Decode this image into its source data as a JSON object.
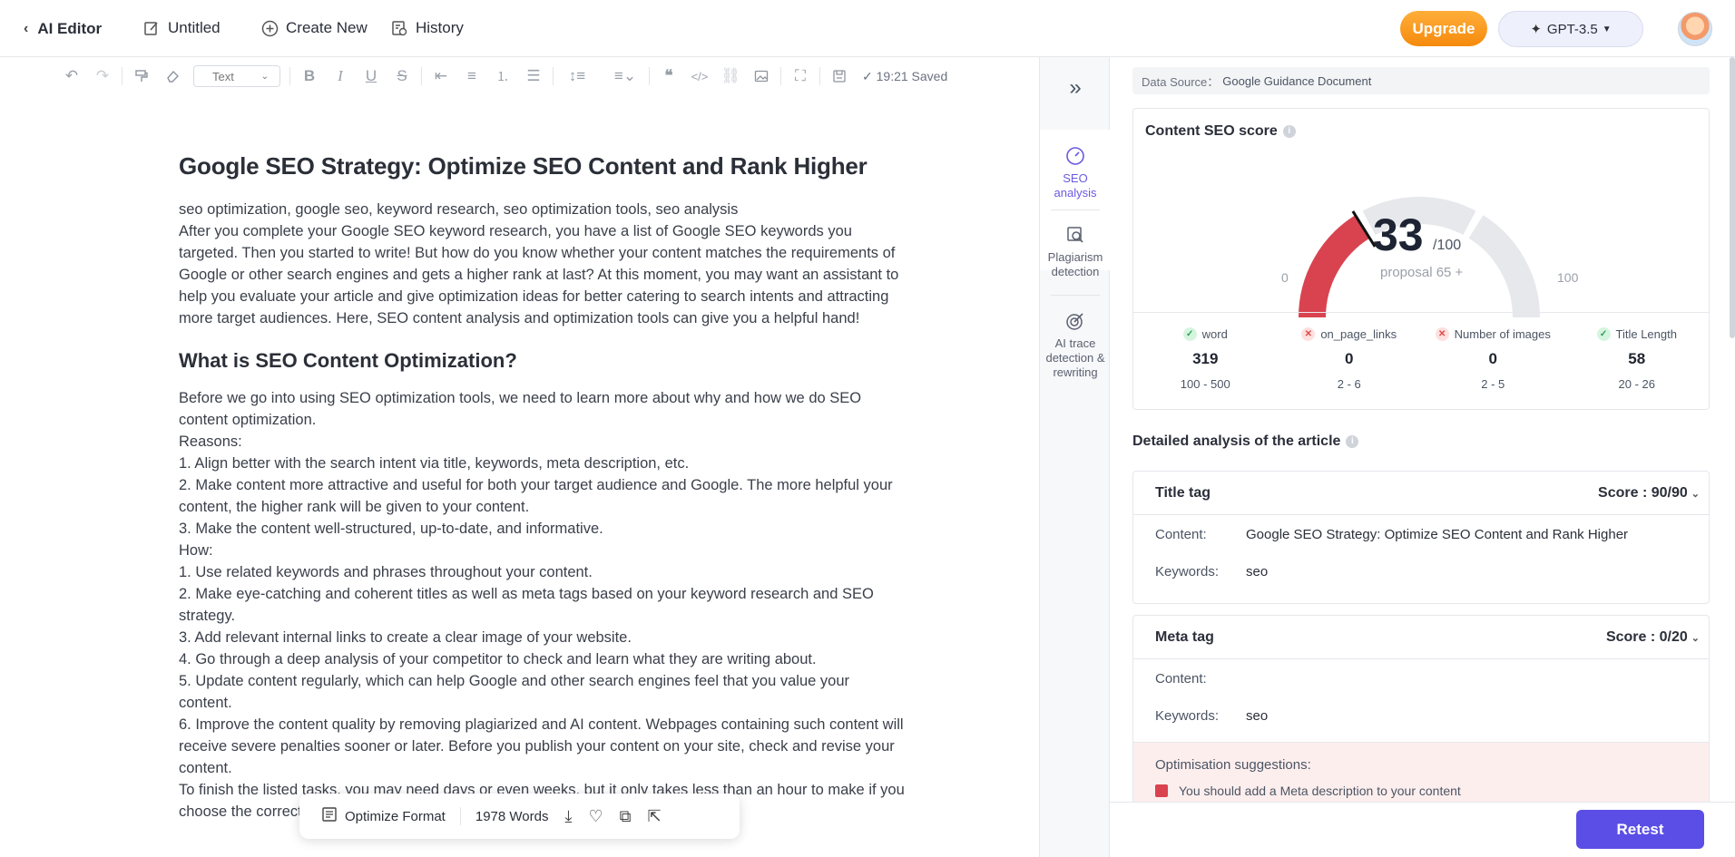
{
  "topbar": {
    "back_label": "AI Editor",
    "untitled_label": "Untitled",
    "create_label": "Create New",
    "history_label": "History",
    "upgrade_label": "Upgrade",
    "model_label": "GPT-3.5"
  },
  "toolbar": {
    "text_style": "Text",
    "saved_status": "✓ 19:21 Saved"
  },
  "document": {
    "title": "Google SEO Strategy: Optimize SEO Content and Rank Higher",
    "paragraphs_1": [
      "seo optimization, google seo, keyword research, seo optimization tools, seo analysis",
      "After you complete your Google SEO keyword research, you have a list of Google SEO keywords you targeted. Then you started to write! But how do you know whether your content matches the requirements of Google or other search engines and gets a higher rank at last? At this moment, you may want an assistant to help you evaluate your article and give optimization ideas for better catering to search intents and attracting more target audiences. Here, SEO content analysis and optimization tools can give you a helpful hand!"
    ],
    "heading_2": "What is SEO Content Optimization?",
    "paragraphs_2": [
      "Before we go into using SEO optimization tools, we need to learn more about why and how we do SEO content optimization.",
      "Reasons:",
      "1. Align better with the search intent via title, keywords, meta description, etc.",
      "2. Make content more attractive and useful for both your target audience and Google. The more helpful your content, the higher rank will be given to your content.",
      "3. Make the content well-structured, up-to-date, and informative.",
      "How:",
      "1. Use related keywords and phrases throughout your content.",
      "2. Make eye-catching and coherent titles as well as meta tags based on your keyword research and SEO strategy.",
      "3. Add relevant internal links to create a clear image of your website.",
      "4. Go through a deep analysis of your competitor to check and learn what they are writing about.",
      "5. Update content regularly, which can help Google and other search engines feel that you value your content.",
      "6. Improve the content quality by removing plagiarized and AI content. Webpages containing such content will receive severe penalties sooner or later. Before you publish your content on your site, check and revise your content.",
      "To finish the listed tasks, you may need days or even weeks, but it only takes less than an hour to make if you choose the correct SEO optimization tool to help you."
    ]
  },
  "floatbar": {
    "optimize_label": "Optimize Format",
    "word_count": "1978 Words"
  },
  "sidebar": {
    "tabs": [
      {
        "label": "SEO analysis"
      },
      {
        "label": "Plagiarism detection"
      },
      {
        "label": "AI trace detection & rewriting"
      }
    ]
  },
  "panel": {
    "data_source_label": "Data Source：",
    "data_source_value": "Google Guidance Document",
    "score_title": "Content SEO score",
    "score": "33",
    "score_max": "/100",
    "proposal": "proposal 65 +",
    "gauge_min": "0",
    "gauge_max": "100",
    "score_fraction": 0.33,
    "metrics": [
      {
        "status": "ok",
        "label": "word",
        "value": "319",
        "range": "100 - 500"
      },
      {
        "status": "bad",
        "label": "on_page_links",
        "value": "0",
        "range": "2 - 6"
      },
      {
        "status": "bad",
        "label": "Number of images",
        "value": "0",
        "range": "2 - 5"
      },
      {
        "status": "ok",
        "label": "Title Length",
        "value": "58",
        "range": "20 - 26"
      }
    ],
    "detail_title": "Detailed analysis of the article",
    "title_tag": {
      "name": "Title tag",
      "score": "Score :  90/90",
      "content_label": "Content:",
      "content_value": "Google SEO Strategy: Optimize SEO Content and Rank Higher",
      "keywords_label": "Keywords:",
      "keywords_value": "seo"
    },
    "meta_tag": {
      "name": "Meta tag",
      "score": "Score :  0/20",
      "content_label": "Content:",
      "content_value": "",
      "keywords_label": "Keywords:",
      "keywords_value": "seo",
      "suggestions_label": "Optimisation suggestions:",
      "suggestion_1": "You should add a Meta description to your content"
    },
    "retest_label": "Retest"
  },
  "colors": {
    "accent": "#5b4ee6",
    "upgrade": "#f59a1e",
    "gauge_fill": "#d9434f",
    "gauge_track": "#e6e8ec"
  }
}
